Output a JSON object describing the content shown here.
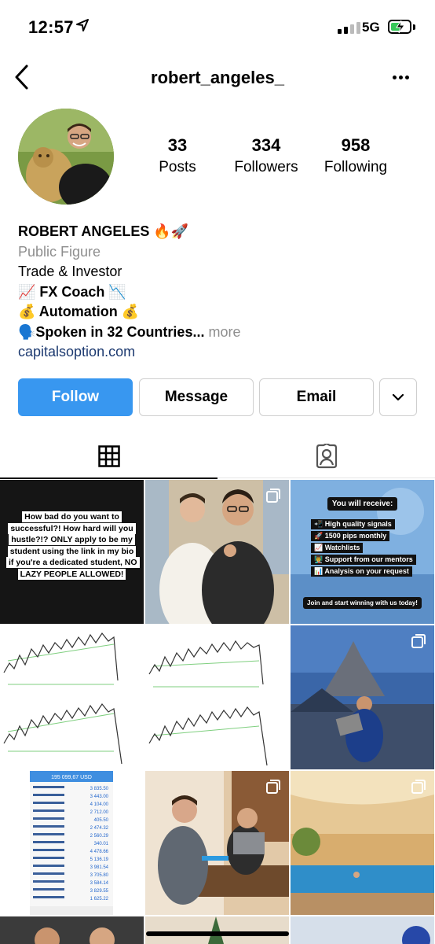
{
  "status_bar": {
    "time": "12:57",
    "network": "5G",
    "signal_bars": 4,
    "signal_bars_active": 2,
    "battery_charging": true
  },
  "header": {
    "username": "robert_angeles_",
    "back_icon": "chevron-left-icon",
    "more_icon": "ellipsis-icon"
  },
  "profile": {
    "stats": [
      {
        "value": "33",
        "label": "Posts"
      },
      {
        "value": "334",
        "label": "Followers"
      },
      {
        "value": "958",
        "label": "Following"
      }
    ],
    "name": "ROBERT ANGELES 🔥🚀",
    "category": "Public Figure",
    "bio_lines": [
      "Trade & Investor",
      "📈 FX Coach 📉",
      "💰 Automation 💰",
      "🗣️Spoken in 32 Countries..."
    ],
    "more_label": " more",
    "link": "capitalsoption.com"
  },
  "actions": {
    "follow": "Follow",
    "message": "Message",
    "email": "Email",
    "dropdown_icon": "chevron-down-icon"
  },
  "tabs": [
    {
      "name": "grid",
      "icon": "grid-icon",
      "active": true
    },
    {
      "name": "tagged",
      "icon": "tagged-person-icon",
      "active": false
    }
  ],
  "posts": {
    "text_post": "How bad do you want to successful?! How hard will you hustle?!? ONLY apply to be my student using the link in my bio if you're a dedicated student, NO LAZY PEOPLE ALLOWED!",
    "signals_heading": "You will receive:",
    "signals_items": [
      "📲 High quality signals",
      "🚀 1500 pips monthly",
      "📈 Watchlists",
      "👨‍🏫 Support from our mentors",
      "📊 Analysis on your request"
    ],
    "signals_footer": "Join and start winning with us today!",
    "account_balance": "195 099,67 USD",
    "trade_values": [
      "3 835.50",
      "3 443.00",
      "4 104.00",
      "2 712.00",
      "405.50",
      "2 474.32",
      "2 560.29",
      "340.01",
      "4 478.66",
      "5 136.19",
      "3 981.54",
      "3 705.80",
      "3 584.14",
      "3 829.55",
      "1 625.22"
    ]
  },
  "colors": {
    "follow_bg": "#3897f0",
    "link": "#1d3a70",
    "muted": "#8e8e8e",
    "battery": "#37c759"
  }
}
